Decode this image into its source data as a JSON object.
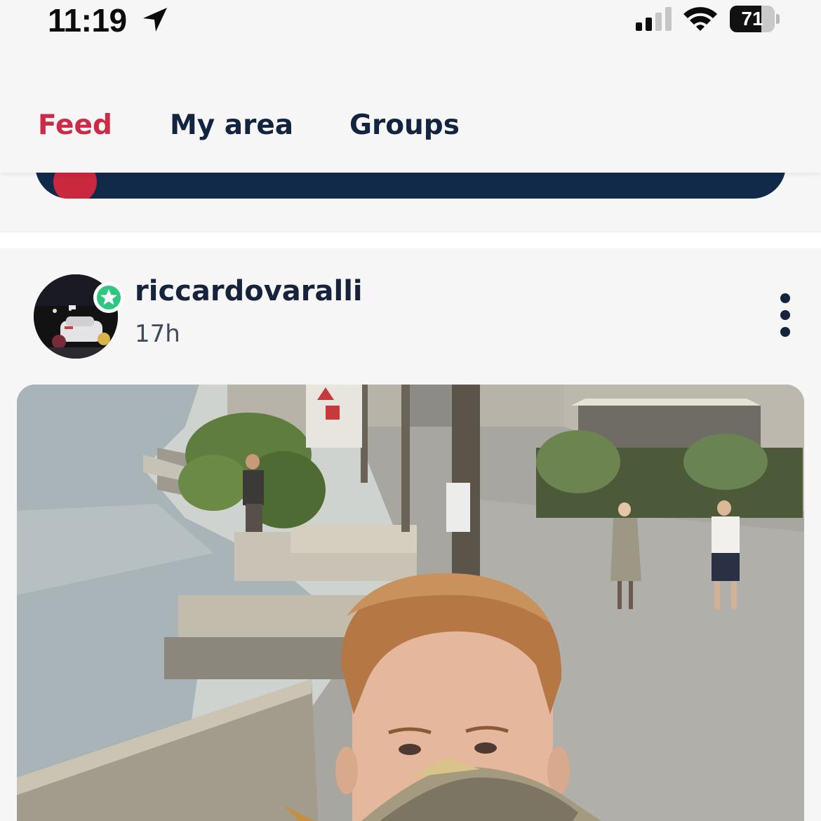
{
  "status_bar": {
    "time": "11:19",
    "battery_percent": "71",
    "battery_level": 0.71,
    "icons": [
      "location-arrow-icon",
      "cellular-signal-icon",
      "wifi-icon",
      "battery-icon"
    ]
  },
  "tabs": [
    {
      "label": "Feed",
      "active": true
    },
    {
      "label": "My area",
      "active": false
    },
    {
      "label": "Groups",
      "active": false
    }
  ],
  "colors": {
    "accent": "#cc2a45",
    "navy": "#12243f",
    "banner": "#122a4a",
    "verified": "#2ec77f"
  },
  "post": {
    "username": "riccardovaralli",
    "time_ago": "17h",
    "menu_icon": "more-vertical-icon",
    "badge_icon": "verified-star-icon",
    "image_description_icon": "post-photo"
  }
}
